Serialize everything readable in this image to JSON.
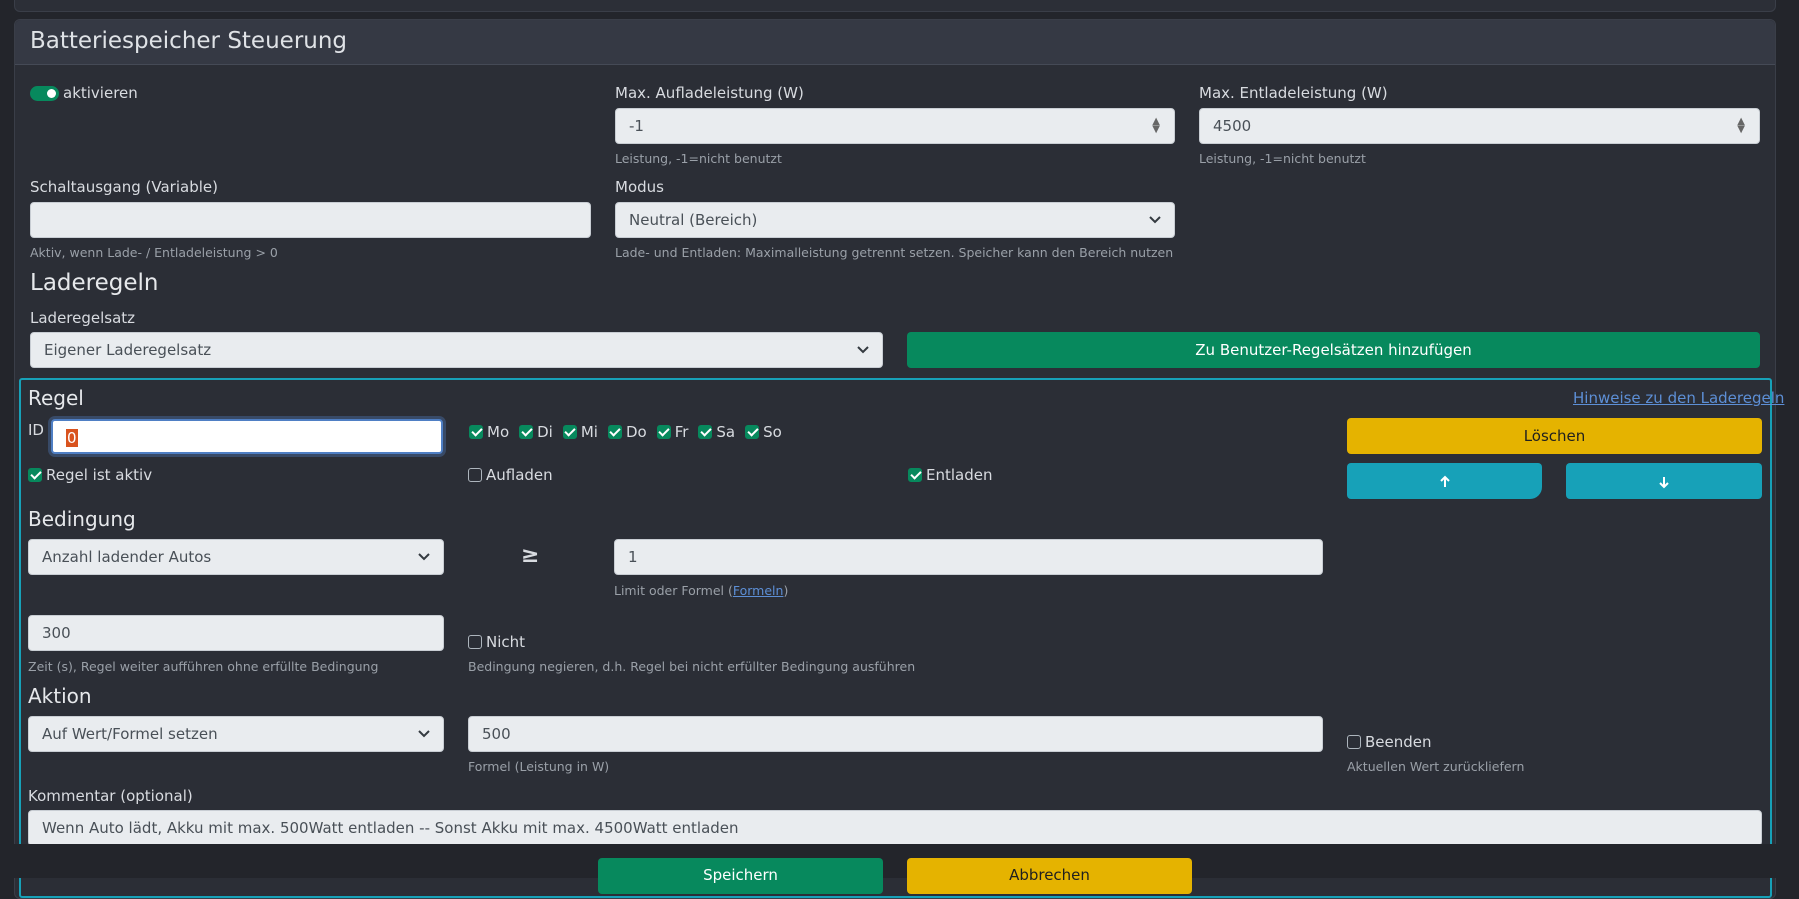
{
  "card": {
    "title": "Batteriespeicher Steuerung"
  },
  "activate": {
    "label": "aktivieren",
    "on": true
  },
  "max_charge": {
    "label": "Max. Aufladeleistung (W)",
    "value": "-1",
    "help": "Leistung, -1=nicht benutzt"
  },
  "max_discharge": {
    "label": "Max. Entladeleistung (W)",
    "value": "4500",
    "help": "Leistung, -1=nicht benutzt"
  },
  "switch_output": {
    "label": "Schaltausgang (Variable)",
    "value": "",
    "help": "Aktiv, wenn Lade- / Entladeleistung > 0"
  },
  "mode": {
    "label": "Modus",
    "value": "Neutral (Bereich)",
    "help": "Lade- und Entladen: Maximalleistung getrennt setzen. Speicher kann den Bereich nutzen"
  },
  "charge_rules": {
    "heading": "Laderegeln",
    "ruleset_label": "Laderegelsatz",
    "ruleset_value": "Eigener Laderegelsatz",
    "add_button": "Zu Benutzer-Regelsätzen hinzufügen"
  },
  "rule": {
    "heading": "Regel",
    "hint_link": "Hinweise zu den Laderegeln",
    "id_label": "ID",
    "id_value": "0",
    "days": [
      {
        "label": "Mo",
        "checked": true
      },
      {
        "label": "Di",
        "checked": true
      },
      {
        "label": "Mi",
        "checked": true
      },
      {
        "label": "Do",
        "checked": true
      },
      {
        "label": "Fr",
        "checked": true
      },
      {
        "label": "Sa",
        "checked": true
      },
      {
        "label": "So",
        "checked": true
      }
    ],
    "delete_button": "Löschen",
    "up_icon": "arrow-up-icon",
    "down_icon": "arrow-down-icon",
    "active_label": "Regel ist aktiv",
    "charge_label": "Aufladen",
    "discharge_label": "Entladen"
  },
  "condition": {
    "heading": "Bedingung",
    "variable": "Anzahl ladender Autos",
    "operator": "≥",
    "limit_value": "1",
    "limit_help_prefix": "Limit oder Formel (",
    "limit_help_link": "Formeln",
    "limit_help_suffix": ")",
    "time_value": "300",
    "time_help": "Zeit (s), Regel weiter aufführen ohne erfüllte Bedingung",
    "not_label": "Nicht",
    "not_help": "Bedingung negieren, d.h. Regel bei nicht erfüllter Bedingung ausführen"
  },
  "action": {
    "heading": "Aktion",
    "type": "Auf Wert/Formel setzen",
    "formula_value": "500",
    "formula_help": "Formel (Leistung in W)",
    "end_label": "Beenden",
    "end_help": "Aktuellen Wert zurückliefern"
  },
  "comment": {
    "label": "Kommentar (optional)",
    "value": "Wenn Auto lädt, Akku mit max. 500Watt entladen -- Sonst Akku mit max. 4500Watt entladen"
  },
  "footer": {
    "save_button": "Speichern",
    "cancel_button": "Abbrechen"
  },
  "colors": {
    "accent_green": "#07895d",
    "accent_yellow": "#e5b300",
    "accent_cyan": "#17a1b8"
  }
}
